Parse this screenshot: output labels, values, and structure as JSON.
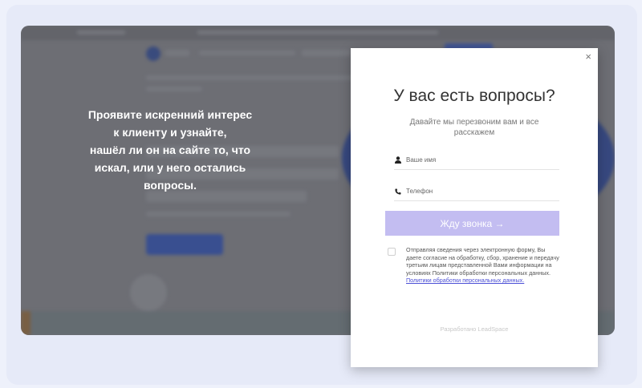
{
  "promo": {
    "lines": [
      "Проявите искренний интерес",
      "к клиенту и узнайте,",
      "нашёл ли он на сайте то, что",
      "искал, или у него остались",
      "вопросы."
    ]
  },
  "modal": {
    "close_label": "×",
    "title": "У вас есть вопросы?",
    "subtitle": "Давайте мы перезвоним вам и все расскажем",
    "name_placeholder": "Ваше имя",
    "phone_placeholder": "Телефон",
    "submit_label": "Жду звонка →",
    "consent_text": "Отправляя сведения через электронную форму, Вы даете согласие на обработку, сбор, хранение и передачу третьим лицам представленной Вами информации на условиях Политики обработки персональных данных. ",
    "consent_link": "Политики обработки персональных данных.",
    "credit": "Разработано LeadSpace"
  },
  "colors": {
    "submit_bg": "#c3bdf1",
    "link": "#4b4fd6",
    "card_bg": "#e6eaf8"
  },
  "icons": {
    "close": "close-icon",
    "name": "user-icon",
    "phone": "phone-icon"
  }
}
